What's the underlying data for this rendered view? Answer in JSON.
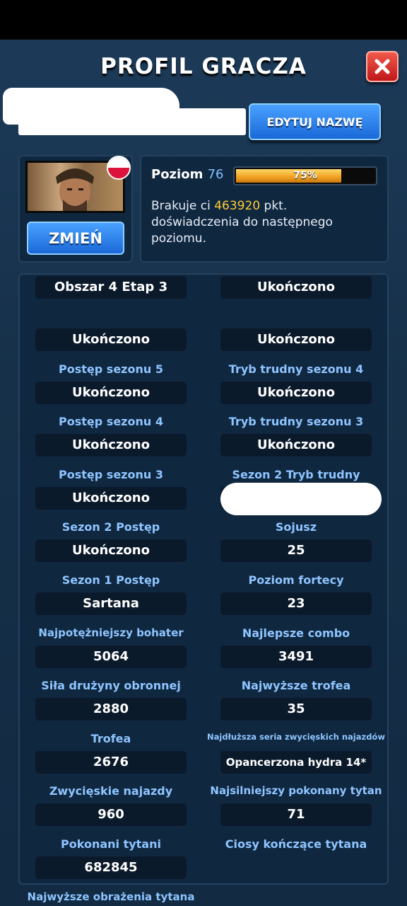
{
  "header": {
    "title": "PROFIL GRACZA",
    "close_icon": "close-x-icon"
  },
  "name_section": {
    "player_name": "",
    "edit_button": "EDYTUJ NAZWĘ"
  },
  "avatar": {
    "change_button": "ZMIEŃ",
    "flag": "poland-flag-icon"
  },
  "level": {
    "label": "Poziom",
    "value": "76",
    "progress_text": "75%",
    "progress_fraction": 0.75,
    "xp_before": "Brakuje ci",
    "xp_missing": "463920",
    "xp_after": "pkt. doświadczenia do następnego poziomu."
  },
  "stats": [
    {
      "label": "",
      "value": "Obszar 4 Etap 3"
    },
    {
      "label": "",
      "value": "Ukończono"
    },
    {
      "label": "Postęp sezonu 5",
      "value": "Ukończono"
    },
    {
      "label": "Tryb trudny sezonu 4",
      "value": "Ukończono"
    },
    {
      "label": "Postęp sezonu 4",
      "value": "Ukończono"
    },
    {
      "label": "Tryb trudny sezonu 3",
      "value": "Ukończono"
    },
    {
      "label": "Postęp sezonu 3",
      "value": "Ukończono"
    },
    {
      "label": "Sezon 2 Tryb trudny",
      "value": "Ukończono"
    },
    {
      "label": "Sezon 2 Postęp",
      "value": "Ukończono"
    },
    {
      "label": "Sojusz",
      "value": ""
    },
    {
      "label": "Sezon 1 Postęp",
      "value": "Ukończono"
    },
    {
      "label": "Poziom fortecy",
      "value": "25"
    },
    {
      "label": "Najpotężniejszy bohater",
      "value": "Sartana"
    },
    {
      "label": "Najlepsze combo",
      "value": "23"
    },
    {
      "label": "Siła drużyny obronnej",
      "value": "5064"
    },
    {
      "label": "Najwyższe trofea",
      "value": "3491"
    },
    {
      "label": "Trofea",
      "value": "2880"
    },
    {
      "label": "Najdłuższa seria zwycięskich najazdów",
      "value": "35"
    },
    {
      "label": "Zwycięskie najazdy",
      "value": "2676"
    },
    {
      "label": "Najsilniejszy pokonany tytan",
      "value": "Opancerzona hydra 14*"
    },
    {
      "label": "Pokonani tytani",
      "value": "960"
    },
    {
      "label": "Ciosy kończące tytana",
      "value": "71"
    },
    {
      "label": "Najwyższe obrażenia tytana",
      "value": "682845"
    }
  ]
}
